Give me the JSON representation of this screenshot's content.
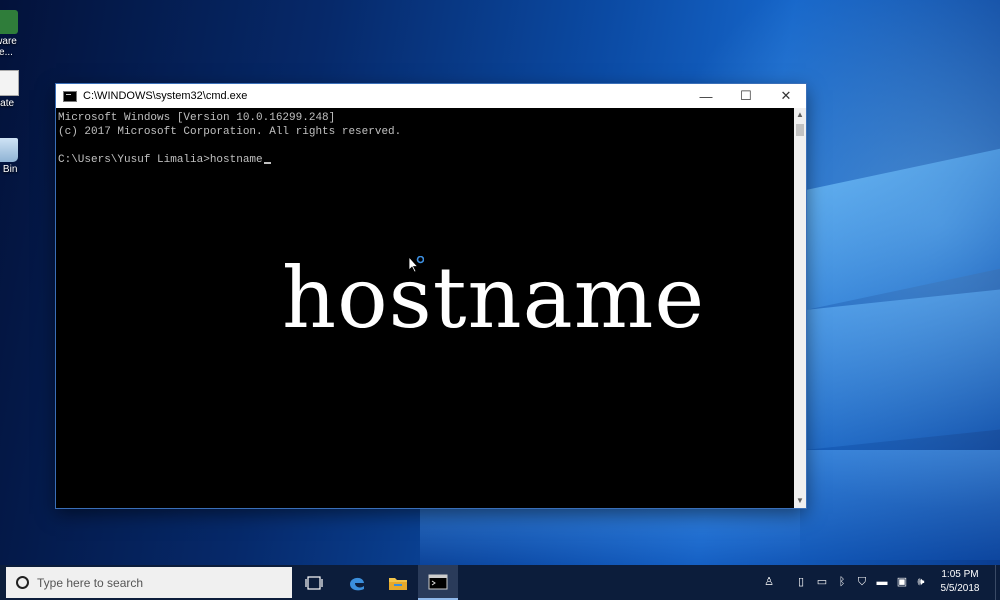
{
  "desktop": {
    "icons": [
      {
        "label": "ware\ne..."
      },
      {
        "label": "late"
      },
      {
        "label": "e Bin"
      }
    ]
  },
  "window": {
    "title": "C:\\WINDOWS\\system32\\cmd.exe",
    "minimize": "—",
    "maximize": "☐",
    "close": "✕",
    "lines": [
      "Microsoft Windows [Version 10.0.16299.248]",
      "(c) 2017 Microsoft Corporation. All rights reserved.",
      "",
      "C:\\Users\\Yusuf Limalia>hostname"
    ]
  },
  "overlay": {
    "text": "hostname"
  },
  "taskbar": {
    "search_placeholder": "Type here to search",
    "clock_time": "1:05 PM",
    "clock_date": "5/5/2018"
  },
  "colors": {
    "accent": "#1565c9",
    "taskbar": "#0c1d3b",
    "console_text": "#c0c0c0"
  }
}
